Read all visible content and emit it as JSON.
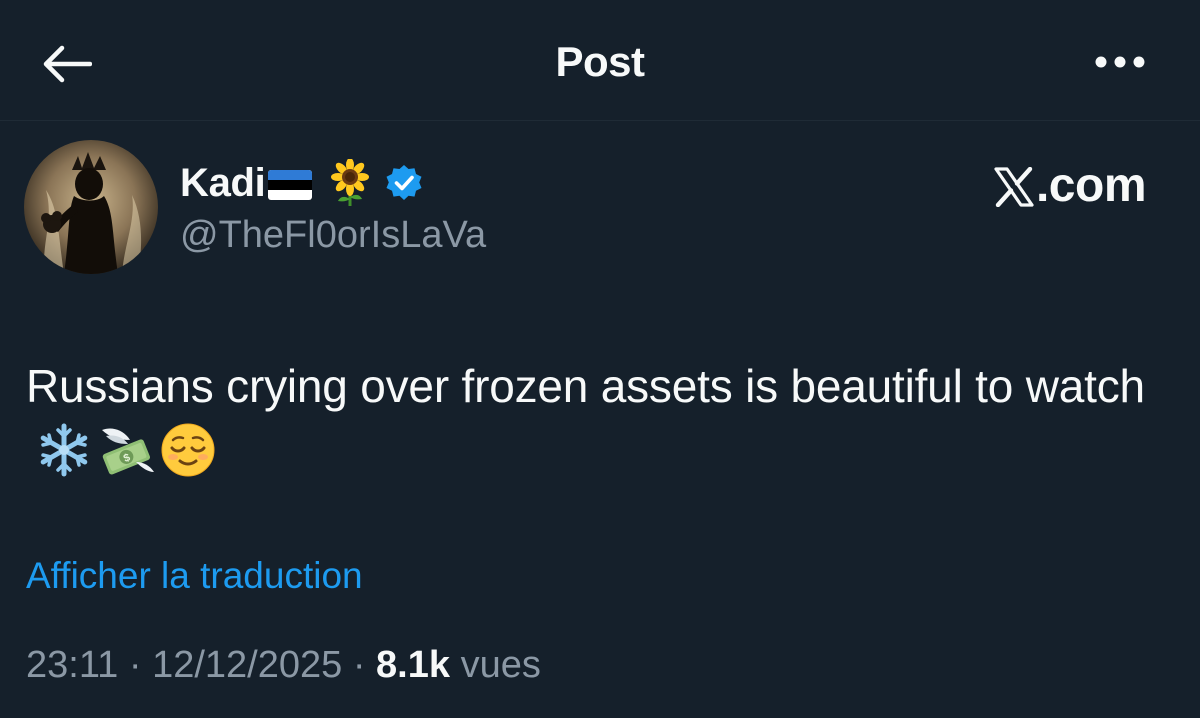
{
  "header": {
    "title": "Post",
    "back_icon": "arrow-left-icon",
    "more_icon": "more-horizontal-icon"
  },
  "author": {
    "display_name": "Kadi",
    "flag_emoji": "estonia-flag",
    "extra_emoji": "sunflower",
    "verified": true,
    "handle": "@TheFl0orIsLaVa"
  },
  "brand": {
    "text": ".com",
    "logo": "x-logo"
  },
  "tweet": {
    "text": "Russians crying over frozen assets is beautiful to watch",
    "emojis": [
      "snowflake",
      "money-with-wings",
      "relieved-face"
    ]
  },
  "translate_label": "Afficher la traduction",
  "meta": {
    "time": "23:11",
    "separator": "·",
    "date": "12/12/2025",
    "views_count": "8.1k",
    "views_label": "vues"
  },
  "colors": {
    "background": "#15202b",
    "text": "#f7f9f9",
    "muted": "#8b98a5",
    "link": "#1d9bf0",
    "verified": "#1d9bf0"
  }
}
